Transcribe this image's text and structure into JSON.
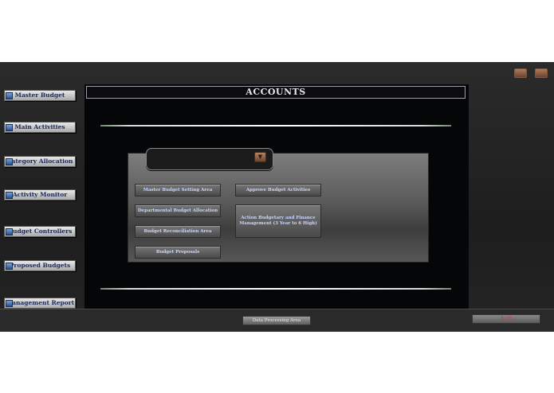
{
  "window": {
    "title": "ACCOUNTS"
  },
  "sidebar": {
    "items": [
      {
        "label": "Master Budget"
      },
      {
        "label": "Main Activities"
      },
      {
        "label": "Category Allocation"
      },
      {
        "label": "Activity Monitor"
      },
      {
        "label": "Budget Controllers"
      },
      {
        "label": "Proposed Budgets"
      },
      {
        "label": "Management Report"
      }
    ]
  },
  "main": {
    "dropdown": {
      "value": ""
    },
    "buttons": {
      "master_setting": "Master Budget Setting Area",
      "departmental_allocation": "Departmental Budget Allocation",
      "reconciliation": "Budget Reconciliation Area",
      "proposals": "Budget Proposals",
      "approve_activities": "Approve Budget Activities",
      "action_budgetary": "Action Budgetary and Finance Management (3 Year to 6 High)"
    }
  },
  "status_bar": {
    "data_processing_label": "Data Processing Area",
    "exit_label": "Exit"
  },
  "icons": {
    "top_left": "minimize-icon",
    "top_right": "close-icon",
    "sidebar_button": "blue-square-icon",
    "dropdown_arrow": "chevron-down-icon"
  },
  "colors": {
    "accent_text": "#c9d6ff",
    "exit_text": "#d23a3a"
  }
}
